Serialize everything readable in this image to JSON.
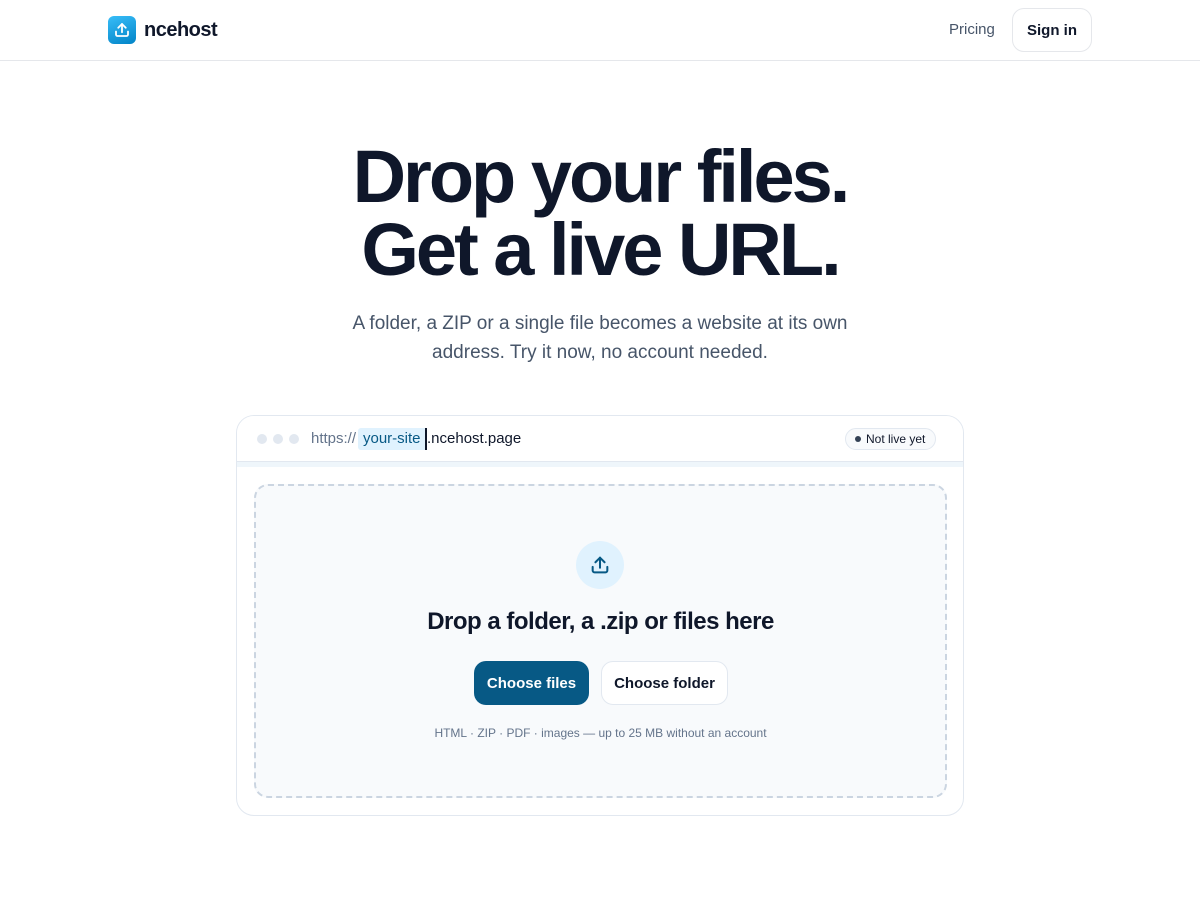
{
  "brand": {
    "name": "ncehost",
    "logo_icon": "upload-icon",
    "logo_color": "#0ea5e9"
  },
  "nav": {
    "pricing_label": "Pricing",
    "signin_label": "Sign in"
  },
  "hero": {
    "title_line1": "Drop your files.",
    "title_line2": "Get a live URL.",
    "subtitle": "A folder, a ZIP or a single file becomes a website at its own address. Try it now, no account needed."
  },
  "urlbar": {
    "prefix": "https://",
    "subdomain": "your-site",
    "domain": ".ncehost.page",
    "status": "Not live yet"
  },
  "dropzone": {
    "icon": "upload-icon",
    "title": "Drop a folder, a .zip or files here",
    "primary_button": "Choose files",
    "secondary_button": "Choose folder",
    "hint": "HTML · ZIP · PDF · images — up to 25 MB without an account"
  },
  "colors": {
    "accent": "#075985",
    "text": "#0f172a",
    "muted": "#475569"
  }
}
